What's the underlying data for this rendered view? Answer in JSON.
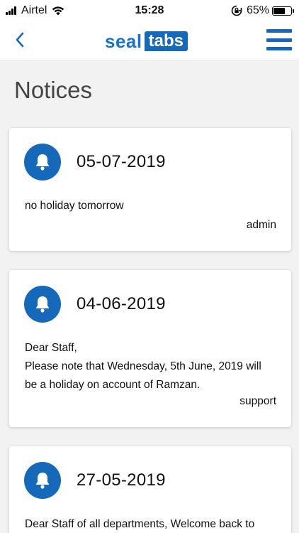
{
  "status_bar": {
    "carrier": "Airtel",
    "time": "15:28",
    "battery_percent": "65%",
    "battery_level": 0.65
  },
  "header": {
    "logo_left": "seal",
    "logo_right": "tabs",
    "brand_color": "#1569b8"
  },
  "page": {
    "title": "Notices"
  },
  "notices": [
    {
      "date": "05-07-2019",
      "lines": [
        "no holiday tomorrow"
      ],
      "author": "admin"
    },
    {
      "date": "04-06-2019",
      "lines": [
        "Dear Staff,",
        "Please note that Wednesday, 5th June, 2019 will",
        "be a holiday on account of Ramzan."
      ],
      "author": "support"
    },
    {
      "date": "27-05-2019",
      "lines": [
        "Dear Staff of all departments, Welcome back to"
      ],
      "author": ""
    }
  ],
  "icons": {
    "back": "chevron-left-icon",
    "menu": "hamburger-menu-icon",
    "notice": "bell-icon"
  }
}
